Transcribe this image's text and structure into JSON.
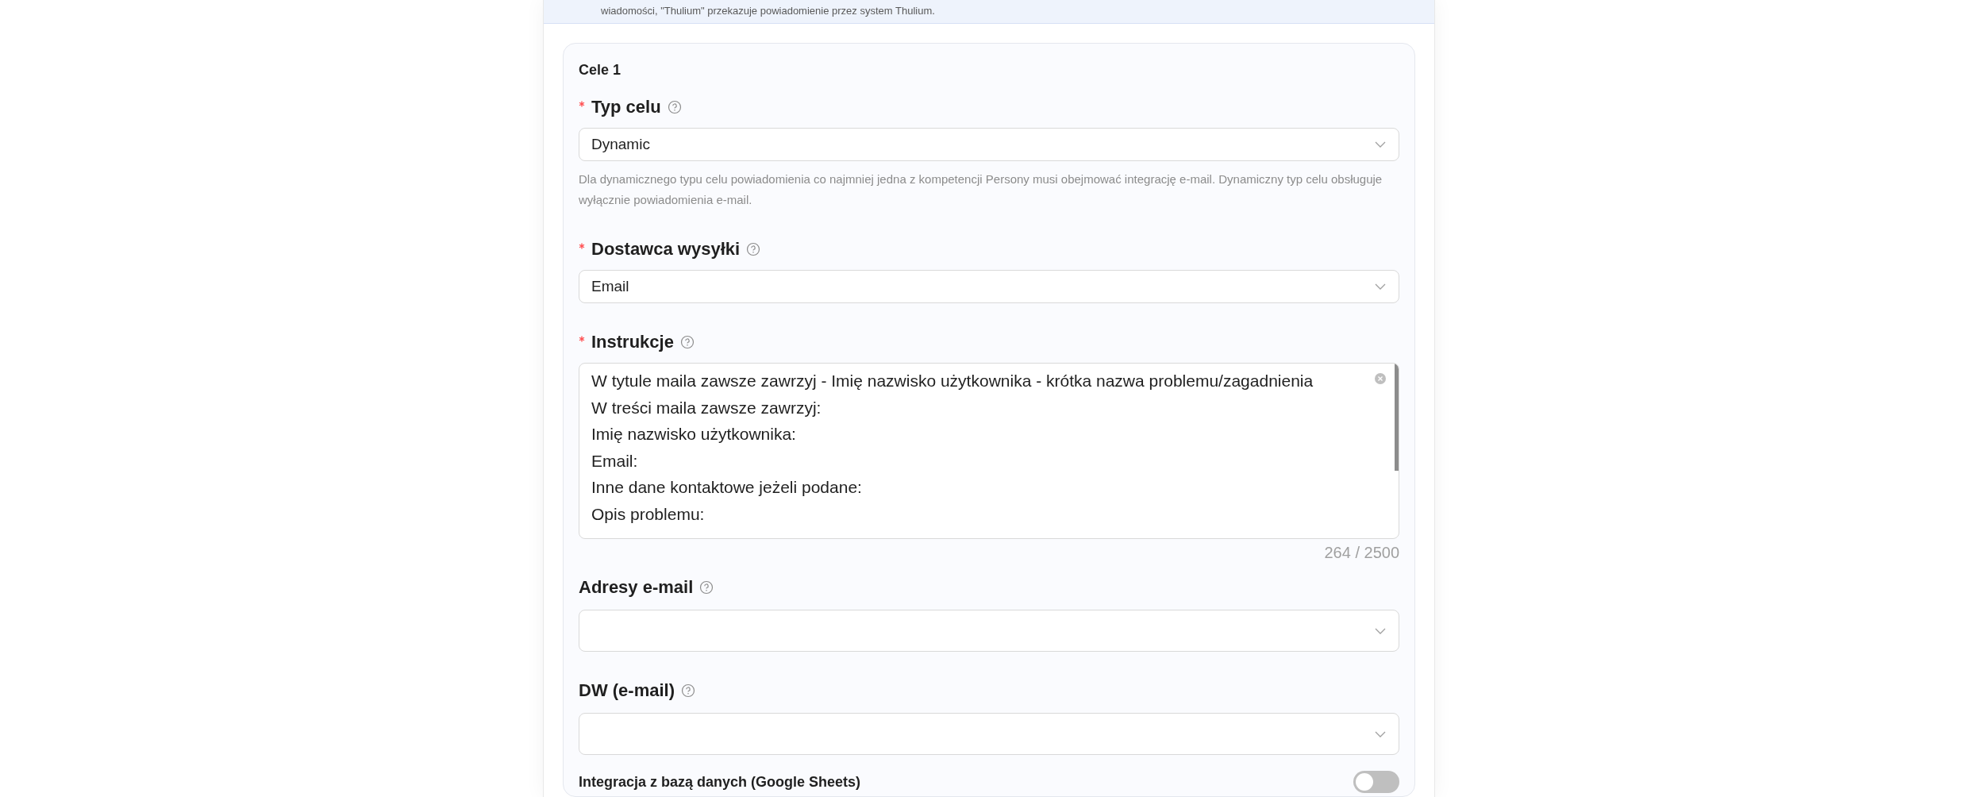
{
  "banner": {
    "text": "wiadomości, \"Thulium\" przekazuje powiadomienie przez system Thulium."
  },
  "card": {
    "title": "Cele 1",
    "fields": [
      {
        "kind": "select",
        "label": "Typ celu",
        "required": true,
        "value": "Dynamic",
        "hint": "Dla dynamicznego typu celu powiadomienia co najmniej jedna z kompetencji Persony musi obejmować integrację e-mail. Dynamiczny typ celu obsługuje wyłącznie powiadomienia e-mail."
      },
      {
        "kind": "select",
        "label": "Dostawca wysyłki",
        "required": true,
        "value": "Email"
      },
      {
        "kind": "textarea",
        "label": "Instrukcje",
        "required": true,
        "lines": [
          "W tytule maila zawsze zawrzyj - Imię nazwisko użytkownika - krótka nazwa problemu/zagadnienia",
          "W treści maila zawsze zawrzyj:",
          "Imię nazwisko użytkownika:",
          "Email:",
          "Inne dane kontaktowe jeżeli podane:",
          "Opis problemu:"
        ],
        "counter": "264 / 2500"
      },
      {
        "kind": "tags",
        "label": "Adresy e-mail",
        "required": false
      },
      {
        "kind": "tags",
        "label": "DW (e-mail)",
        "required": false
      }
    ],
    "toggle": {
      "label": "Integracja z bazą danych (Google Sheets)",
      "on": false
    }
  }
}
